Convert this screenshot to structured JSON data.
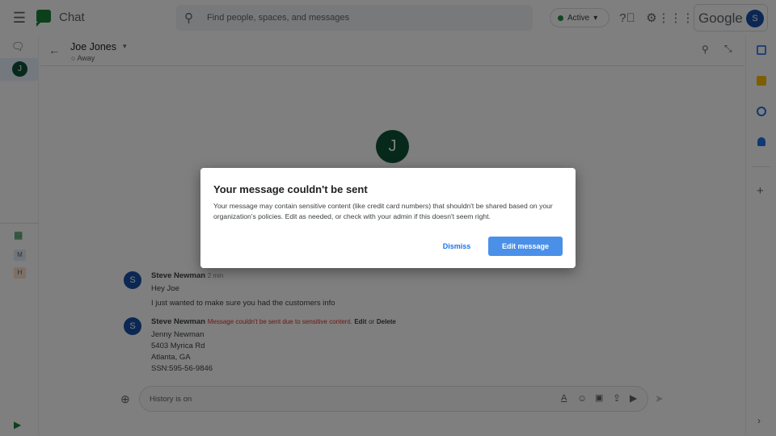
{
  "app": {
    "title": "Chat",
    "search_placeholder": "Find people, spaces, and messages",
    "status": "Active",
    "brand": "Google",
    "user_initial": "S"
  },
  "conversation": {
    "name": "Joe Jones",
    "presence": "Away",
    "avatar_initial": "J"
  },
  "messages": [
    {
      "sender": "Steve Newman",
      "time": "2 min",
      "initial": "S",
      "lines": [
        "Hey Joe",
        "I just wanted to make sure you had the customers info"
      ]
    },
    {
      "sender": "Steve Newman",
      "initial": "S",
      "error": "Message couldn't be sent due to sensitive content.",
      "edit": "Edit",
      "or": "or",
      "delete": "Delete",
      "lines": [
        "Jenny Newman",
        "5403 Myrica Rd",
        "Atlanta, GA",
        "SSN:595-56-9846"
      ]
    }
  ],
  "compose": {
    "placeholder": "History is on"
  },
  "sidebar": {
    "items": [
      "M",
      "H"
    ]
  },
  "dialog": {
    "title": "Your message couldn't be sent",
    "body": "Your message may contain sensitive content (like credit card numbers) that shouldn't be shared based on your organization's policies. Edit as needed, or check with your admin if this doesn't seem right.",
    "dismiss": "Dismiss",
    "edit": "Edit message"
  },
  "colors": {
    "accent": "#1a73e8",
    "error": "#d93025",
    "active": "#1e8e3e"
  }
}
